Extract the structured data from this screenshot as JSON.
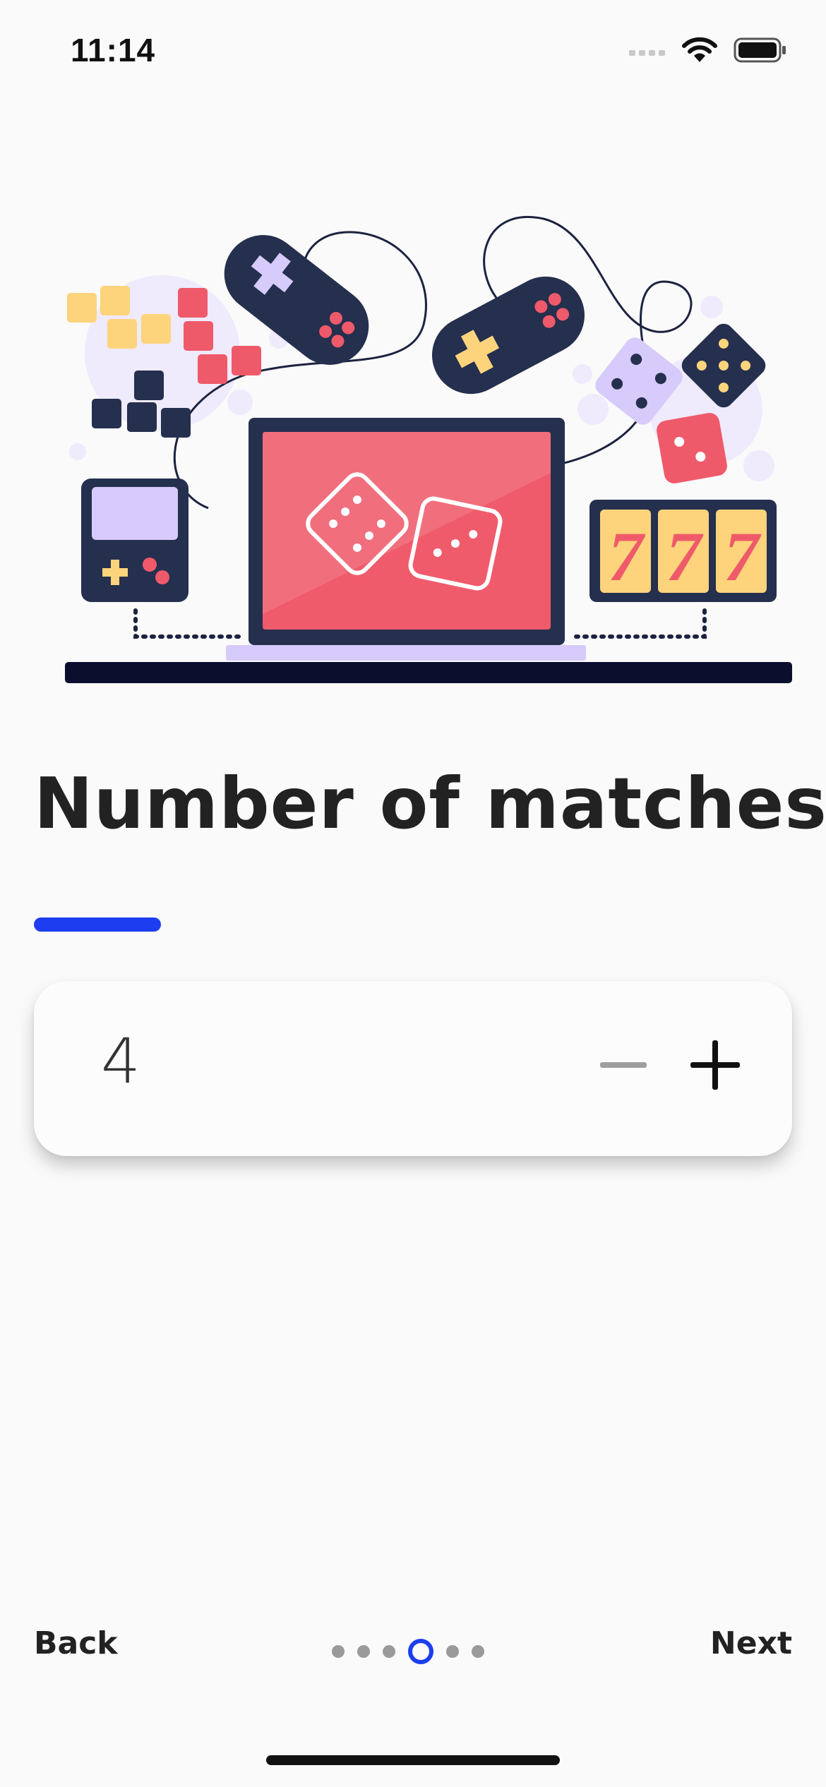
{
  "status_bar": {
    "time": "11:14",
    "icons": [
      "cellular-signal-icon",
      "wifi-icon",
      "battery-icon"
    ]
  },
  "illustration": {
    "name": "gaming-illustration",
    "slot_machine_digits": [
      "7",
      "7",
      "7"
    ]
  },
  "title": "Number of matches",
  "stepper": {
    "value": "4",
    "minus_icon": "minus-icon",
    "plus_icon": "plus-icon"
  },
  "footer": {
    "back_label": "Back",
    "next_label": "Next",
    "page_count": 6,
    "current_page": 4
  },
  "colors": {
    "accent": "#1c3ef0",
    "text": "#222222",
    "background": "#fafafa",
    "illustration_red": "#ef5a6a",
    "illustration_navy": "#252f4e",
    "illustration_yellow": "#fecc70",
    "illustration_lavender": "#d7cbfb"
  }
}
